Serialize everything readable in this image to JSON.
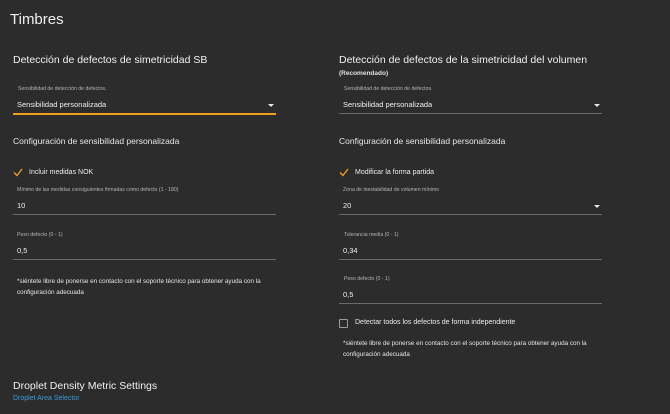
{
  "page": {
    "title": "Timbres"
  },
  "left": {
    "title": "Detección de defectos de simetricidad SB",
    "sensitivity": {
      "label": "Sensibilidad de detección de defectos.",
      "value": "Sensibilidad personalizada"
    },
    "config_title": "Configuración de sensibilidad personalizada",
    "check_nok": {
      "label": "Incluir medidas NOK",
      "checked": true
    },
    "min_consecutive": {
      "label": "Mínimo de las medidas consiguientes firmadas como defecto (1 - 180)",
      "value": "10"
    },
    "weight": {
      "label": "Peso defecto (0 - 1)",
      "value": "0,5"
    },
    "note": "*siéntete libre de ponerse en contacto con el soporte técnico para obtener ayuda con la configuración adecuada"
  },
  "right": {
    "title": "Detección de defectos de la simetricidad del volumen",
    "recommended": "(Recomendado)",
    "sensitivity": {
      "label": "Sensibilidad de detección de defectos.",
      "value": "Sensibilidad personalizada"
    },
    "config_title": "Configuración de sensibilidad personalizada",
    "check_shape": {
      "label": "Modificar la forma partida",
      "checked": true
    },
    "instability_zone": {
      "label": "Zona de inestabilidad de volumen mínimo",
      "value": "20"
    },
    "avg_tolerance": {
      "label": "Tolerancia media (0 - 1)",
      "value": "0,34"
    },
    "weight": {
      "label": "Peso defecto (0 - 1)",
      "value": "0,5"
    },
    "check_independent": {
      "label": "Detectar todos los defectos de forma independiente",
      "checked": false
    },
    "note": "*siéntete libre de ponerse en contacto con el soporte técnico para obtener ayuda con la configuración adecuada"
  },
  "bottom": {
    "title": "Droplet Density Metric Settings",
    "link": "Droplet Area Selector"
  },
  "colors": {
    "background": "#2c2c2c",
    "accent": "#f0a020",
    "link": "#3a9ad9",
    "underline": "#6a6a6a"
  }
}
